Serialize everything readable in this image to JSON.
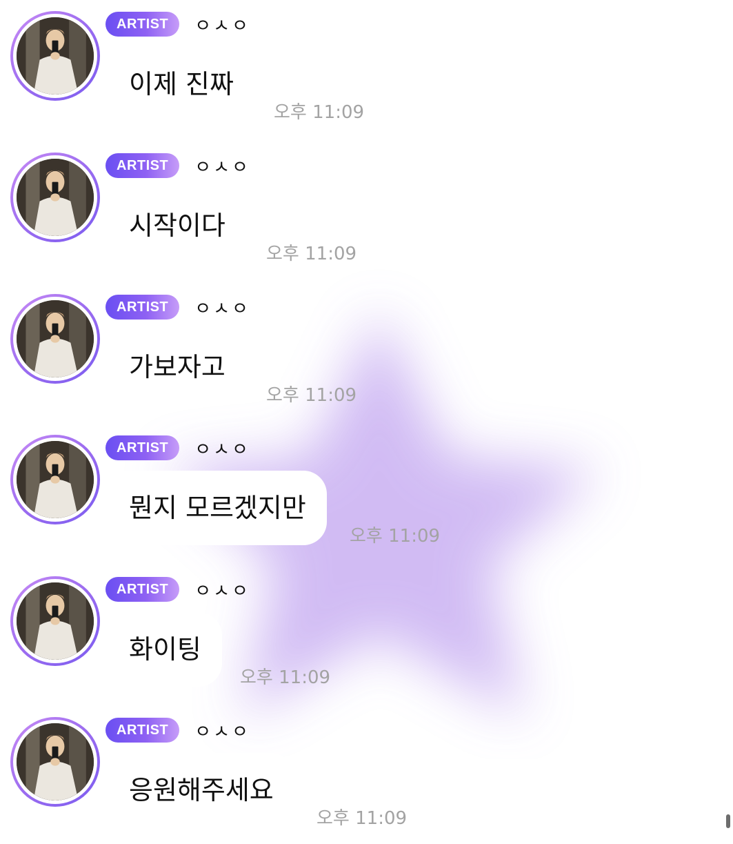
{
  "messages": [
    {
      "badge": "ARTIST",
      "sender": "ㅇㅅㅇ",
      "text": "이제 진짜",
      "time": "오후 11:09"
    },
    {
      "badge": "ARTIST",
      "sender": "ㅇㅅㅇ",
      "text": "시작이다",
      "time": "오후 11:09"
    },
    {
      "badge": "ARTIST",
      "sender": "ㅇㅅㅇ",
      "text": "가보자고",
      "time": "오후 11:09"
    },
    {
      "badge": "ARTIST",
      "sender": "ㅇㅅㅇ",
      "text": "뭔지 모르겠지만",
      "time": "오후 11:09"
    },
    {
      "badge": "ARTIST",
      "sender": "ㅇㅅㅇ",
      "text": "화이팅",
      "time": "오후 11:09"
    },
    {
      "badge": "ARTIST",
      "sender": "ㅇㅅㅇ",
      "text": "응원해주세요",
      "time": "오후 11:09"
    }
  ],
  "colors": {
    "badge_gradient_start": "#6a4ff2",
    "badge_gradient_end": "#c69cf8",
    "avatar_ring": "#9b6cf0",
    "background_star": "#c9b0f2",
    "timestamp": "#a3a3a3"
  },
  "icons": {
    "avatar": "profile-photo",
    "background": "blurred-purple-star"
  }
}
